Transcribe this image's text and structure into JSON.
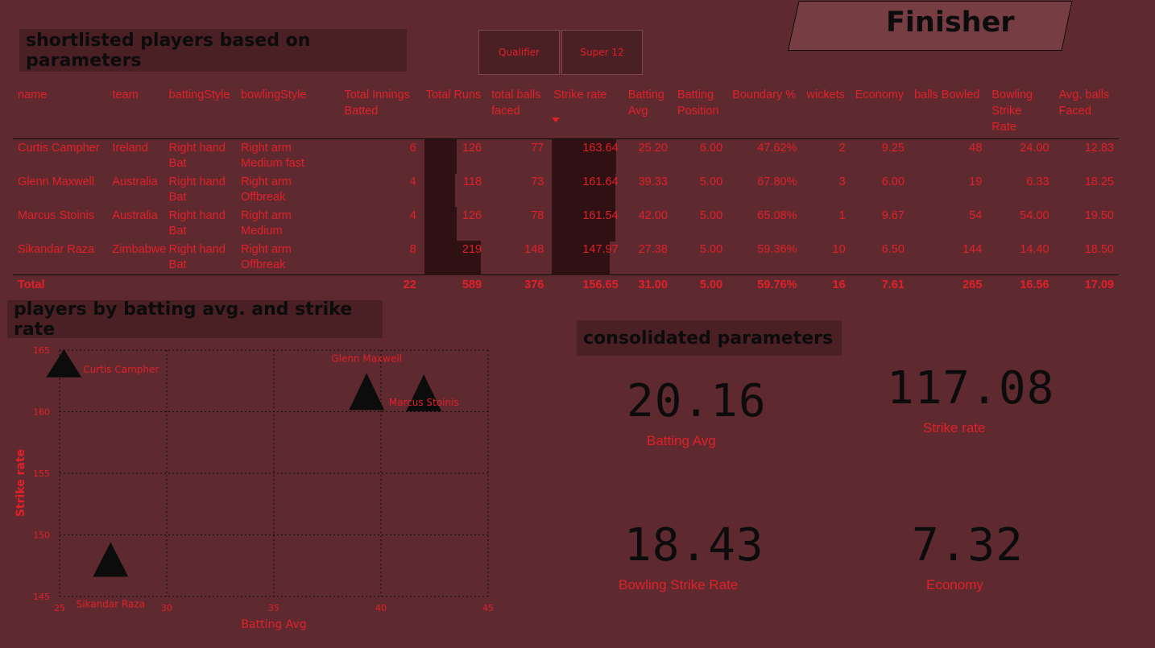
{
  "header": {
    "table_title": "shortlisted players based on parameters",
    "finisher_label": "Finisher",
    "slicer": {
      "options": [
        "Qualifier",
        "Super 12"
      ]
    }
  },
  "table": {
    "columns": [
      "name",
      "team",
      "battingStyle",
      "bowlingStyle",
      "Total Innings Batted",
      "Total Runs",
      "total balls faced",
      "Strike rate",
      "Batting Avg",
      "Batting Position",
      "Boundary %",
      "wickets",
      "Economy",
      "balls Bowled",
      "Bowling Strike Rate",
      "Avg. balls Faced"
    ],
    "rows": [
      [
        "Curtis Campher",
        "Ireland",
        "Right hand Bat",
        "Right arm Medium fast",
        "6",
        "126",
        "77",
        "163.64",
        "25.20",
        "6.00",
        "47.62%",
        "2",
        "9.25",
        "48",
        "24.00",
        "12.83"
      ],
      [
        "Glenn Maxwell",
        "Australia",
        "Right hand Bat",
        "Right arm Offbreak",
        "4",
        "118",
        "73",
        "161.64",
        "39.33",
        "5.00",
        "67.80%",
        "3",
        "6.00",
        "19",
        "6.33",
        "18.25"
      ],
      [
        "Marcus Stoinis",
        "Australia",
        "Right hand Bat",
        "Right arm Medium",
        "4",
        "126",
        "78",
        "161.54",
        "42.00",
        "5.00",
        "65.08%",
        "1",
        "9.67",
        "54",
        "54.00",
        "19.50"
      ],
      [
        "Sikandar Raza",
        "Zimbabwe",
        "Right hand Bat",
        "Right arm Offbreak",
        "8",
        "219",
        "148",
        "147.97",
        "27.38",
        "5.00",
        "59.36%",
        "10",
        "6.50",
        "144",
        "14.40",
        "18.50"
      ]
    ],
    "total": [
      "Total",
      "",
      "",
      "",
      "22",
      "589",
      "376",
      "156.65",
      "31.00",
      "5.00",
      "59.76%",
      "16",
      "7.61",
      "265",
      "16.56",
      "17.09"
    ],
    "runs_bar": [
      126,
      118,
      126,
      219
    ],
    "sr_bar": [
      163.64,
      161.64,
      161.54,
      147.97
    ]
  },
  "scatter": {
    "title": "players by batting avg. and strike rate"
  },
  "chart_data": {
    "type": "scatter",
    "xlabel": "Batting Avg",
    "ylabel": "Strike rate",
    "xlim": [
      25,
      45
    ],
    "ylim": [
      145,
      165
    ],
    "xticks": [
      "25",
      "30",
      "35",
      "40",
      "45"
    ],
    "yticks": [
      "145",
      "150",
      "155",
      "160",
      "165"
    ],
    "grid": true,
    "points": [
      {
        "label": "Curtis Campher",
        "x": 25.2,
        "y": 163.64
      },
      {
        "label": "Glenn Maxwell",
        "x": 39.33,
        "y": 161.64
      },
      {
        "label": "Marcus Stoinis",
        "x": 42.0,
        "y": 161.54
      },
      {
        "label": "Sikandar Raza",
        "x": 27.38,
        "y": 147.97
      }
    ]
  },
  "kpis": {
    "title": "consolidated parameters",
    "batting_avg": {
      "value": "20.16",
      "label": "Batting Avg"
    },
    "strike_rate": {
      "value": "117.08",
      "label": "Strike rate"
    },
    "bowling_sr": {
      "value": "18.43",
      "label": "Bowling Strike Rate"
    },
    "economy": {
      "value": "7.32",
      "label": "Economy"
    }
  },
  "colors": {
    "background": "#5f2a2f",
    "text": "#e0202a",
    "dark": "#0c0c0c",
    "bar": "#2f1114"
  }
}
